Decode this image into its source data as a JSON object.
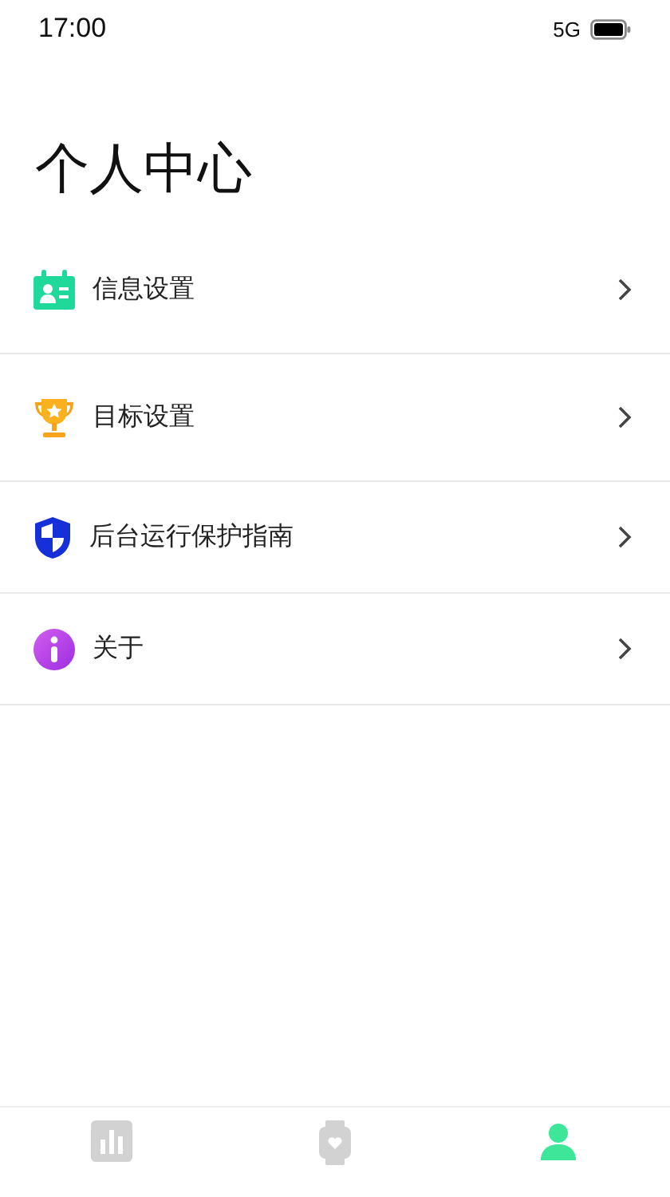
{
  "status_bar": {
    "time": "17:00",
    "network": "5G"
  },
  "title": "个人中心",
  "menu": [
    {
      "kind": "profile",
      "label": "信息设置"
    },
    {
      "kind": "trophy",
      "label": "目标设置"
    },
    {
      "kind": "shield",
      "label": "后台运行保护指南"
    },
    {
      "kind": "info",
      "label": "关于"
    }
  ],
  "tabs": [
    {
      "kind": "chart",
      "selected": false
    },
    {
      "kind": "watch",
      "selected": false
    },
    {
      "kind": "person",
      "selected": true
    }
  ]
}
